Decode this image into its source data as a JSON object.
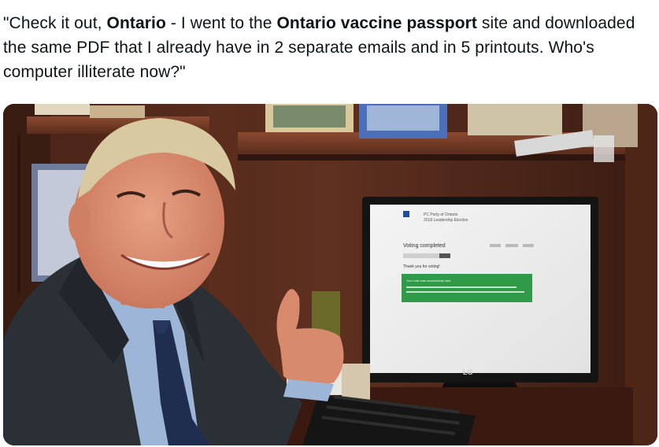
{
  "tweet": {
    "caption_parts": [
      {
        "text": "\"Check it out, ",
        "bold": false
      },
      {
        "text": "Ontario",
        "bold": true
      },
      {
        "text": " - I went to the ",
        "bold": false
      },
      {
        "text": "Ontario vaccine passport",
        "bold": true
      },
      {
        "text": " site and downloaded the same PDF that I already have in 2 separate emails and in 5 printouts.  Who's computer illiterate now?\"",
        "bold": false
      }
    ]
  },
  "photo": {
    "monitor_brand": "LG",
    "screen": {
      "header_title": "PC Party of Ontario",
      "header_subtitle": "2018 Leadership Election",
      "heading": "Voting completed",
      "thanks": "Thank you for voting!",
      "banner_line": "Your vote was successfully cast"
    }
  },
  "colors": {
    "wood_dark": "#3b1e14",
    "wood_mid": "#5a2e1f",
    "screen_green": "#2f9a48",
    "suit": "#2b2f36",
    "shirt": "#9db6d8",
    "skin": "#d98b6e"
  }
}
